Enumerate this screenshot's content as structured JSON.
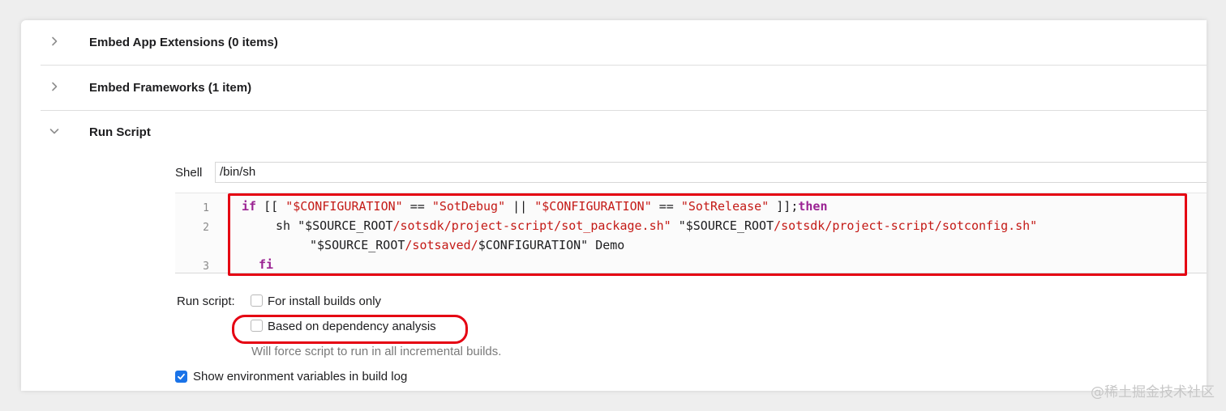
{
  "phases": [
    {
      "title": "Embed App Extensions (0 items)",
      "expanded": false
    },
    {
      "title": "Embed Frameworks (1 item)",
      "expanded": false
    },
    {
      "title": "Run Script",
      "expanded": true
    }
  ],
  "run_script": {
    "shell_label": "Shell",
    "shell_value": "/bin/sh",
    "line_numbers": [
      "1",
      "2",
      "3"
    ],
    "code": {
      "l1_kw_if": "if",
      "l1_a": " [[ ",
      "l1_s1": "\"$CONFIGURATION\"",
      "l1_b": " == ",
      "l1_s2": "\"SotDebug\"",
      "l1_c": " || ",
      "l1_s3": "\"$CONFIGURATION\"",
      "l1_d": " == ",
      "l1_s4": "\"SotRelease\"",
      "l1_e": " ]];",
      "l1_kw_then": "then",
      "l2_cmd": "sh ",
      "l2_q1a": "\"$SOURCE_ROOT",
      "l2_q1b": "/sotsdk/project-script/sot_package.sh\"",
      "l2_sp": " ",
      "l2_q2a": "\"$SOURCE_ROOT",
      "l2_q2b": "/sotsdk/project-script/sotconfig.sh\"",
      "l2w_q3a": "\"$SOURCE_ROOT",
      "l2w_q3b": "/sotsaved/",
      "l2w_q3c": "$CONFIGURATION\"",
      "l2w_demo": " Demo",
      "l3_kw_fi": "fi"
    },
    "options_label": "Run script:",
    "option_install_builds": {
      "label": "For install builds only",
      "checked": false
    },
    "option_dependency": {
      "label": "Based on dependency analysis",
      "checked": false
    },
    "dependency_note": "Will force script to run in all incremental builds.",
    "option_env_vars": {
      "label": "Show environment variables in build log",
      "checked": true
    }
  },
  "watermark": "@稀土掘金技术社区",
  "colors": {
    "keyword": "#9b2393",
    "string": "#c41a16",
    "highlight": "#e50012",
    "checkbox_checked": "#1a73e8"
  }
}
